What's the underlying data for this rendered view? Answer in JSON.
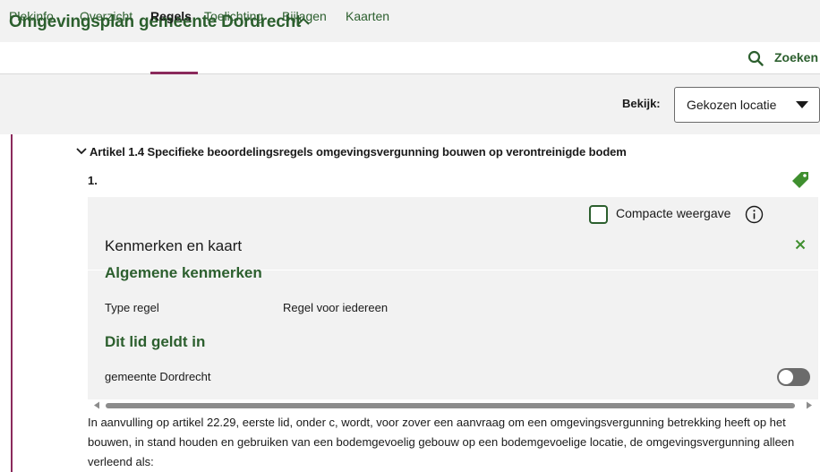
{
  "app": {
    "title": "Omgevingsplan gemeente Dordrecht"
  },
  "nav": {
    "tabs": [
      {
        "label": "Plekinfo",
        "active": false
      },
      {
        "label": "Overzicht",
        "active": false
      },
      {
        "label": "Regels",
        "active": true
      },
      {
        "label": "Toelichting",
        "active": false
      },
      {
        "label": "Bijlagen",
        "active": false
      },
      {
        "label": "Kaarten",
        "active": false
      }
    ],
    "search_label": "Zoeken"
  },
  "view": {
    "label": "Bekijk:",
    "selected": "Gekozen locatie"
  },
  "article": {
    "title": "Artikel 1.4 Specifieke beoordelingsregels omgevingsvergunning bouwen op verontreinigde bodem",
    "lid_number": "1."
  },
  "panel": {
    "title": "Kenmerken en kaart",
    "compact_label": "Compacte weergave",
    "sections": {
      "general": {
        "heading": "Algemene kenmerken",
        "rows": [
          {
            "key": "Type regel",
            "value": "Regel voor iedereen"
          }
        ]
      },
      "applies_in": {
        "heading": "Dit lid geldt in",
        "rows": [
          {
            "key": "gemeente Dordrecht",
            "toggle_on": false
          }
        ]
      }
    }
  },
  "body": {
    "text": "In aanvulling op artikel 22.29, eerste lid, onder c, wordt, voor zover een aanvraag om een omgevingsvergunning betrekking heeft op het bouwen, in stand houden en gebruiken van een bodemgevoelig gebouw op een bodemgevoelige locatie, de omgevingsvergunning alleen verleend als:"
  },
  "colors": {
    "brand_green": "#2c5f2e",
    "accent_magenta": "#8b2a5c",
    "panel_grey": "#f2f2f2",
    "tag_green": "#3f8f2f"
  },
  "icons": {
    "title_toggle": "chevron-up-icon",
    "search": "search-icon",
    "select_caret": "caret-down-icon",
    "article_toggle": "chevron-down-icon",
    "tag": "tag-icon",
    "info": "info-icon",
    "close": "close-icon"
  }
}
